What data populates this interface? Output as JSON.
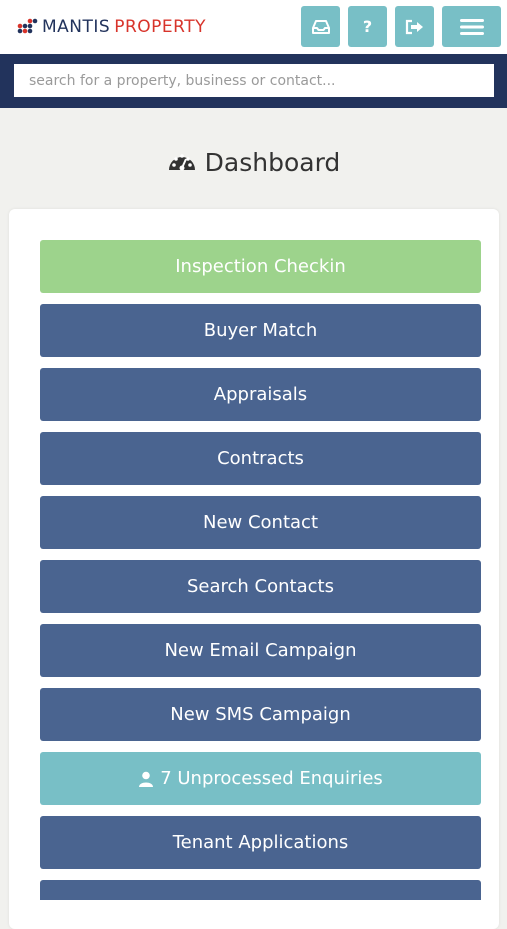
{
  "header": {
    "logo_part1": "MANTIS",
    "logo_part2": "PROPERTY",
    "buttons": [
      {
        "icon": "inbox-icon"
      },
      {
        "icon": "help-icon",
        "label": "?"
      },
      {
        "icon": "logout-icon"
      },
      {
        "icon": "menu-icon"
      }
    ]
  },
  "search": {
    "placeholder": "search for a property, business or contact..."
  },
  "page": {
    "title": "Dashboard",
    "title_icon": "dashboard-icon"
  },
  "dashboard": {
    "buttons": [
      {
        "label": "Inspection Checkin",
        "color": "#9dd38c"
      },
      {
        "label": "Buyer Match",
        "color": "#4a6490"
      },
      {
        "label": "Appraisals",
        "color": "#4a6490"
      },
      {
        "label": "Contracts",
        "color": "#4a6490"
      },
      {
        "label": "New Contact",
        "color": "#4a6490"
      },
      {
        "label": "Search Contacts",
        "color": "#4a6490"
      },
      {
        "label": "New Email Campaign",
        "color": "#4a6490"
      },
      {
        "label": "New SMS Campaign",
        "color": "#4a6490"
      },
      {
        "label": "7 Unprocessed Enquiries",
        "color": "#78bfc6",
        "icon": "user-icon"
      },
      {
        "label": "Tenant Applications",
        "color": "#4a6490"
      },
      {
        "label": "",
        "color": "#4a6490"
      }
    ]
  },
  "colors": {
    "navy": "#22335c",
    "brand_red": "#d8342b",
    "teal": "#78bfc6",
    "button_blue": "#4a6490",
    "green": "#9dd38c"
  }
}
